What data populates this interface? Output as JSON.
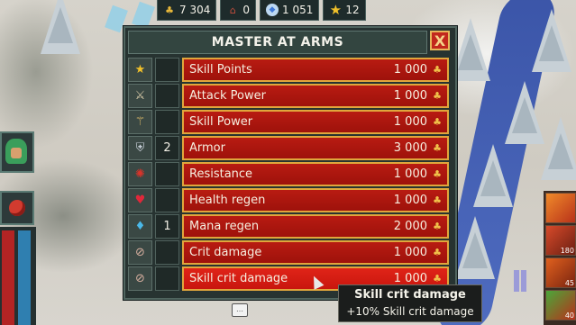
{
  "resources": [
    {
      "icon": "gold-coins-icon",
      "value": "7 304"
    },
    {
      "icon": "population-icon",
      "value": "0"
    },
    {
      "icon": "gem-icon",
      "value": "1 051"
    },
    {
      "icon": "star-icon",
      "value": "12"
    }
  ],
  "dialog": {
    "title": "MASTER AT ARMS",
    "close_label": "X",
    "rows": [
      {
        "icon": "star-icon",
        "level": "",
        "label": "Skill Points",
        "cost": "1 000"
      },
      {
        "icon": "sword-icon",
        "level": "",
        "label": "Attack Power",
        "cost": "1 000"
      },
      {
        "icon": "magic-wand-icon",
        "level": "",
        "label": "Skill Power",
        "cost": "1 000"
      },
      {
        "icon": "shield-icon",
        "level": "2",
        "label": "Armor",
        "cost": "3 000"
      },
      {
        "icon": "resistance-icon",
        "level": "",
        "label": "Resistance",
        "cost": "1 000"
      },
      {
        "icon": "heart-icon",
        "level": "",
        "label": "Health regen",
        "cost": "1 000"
      },
      {
        "icon": "mana-crystal-icon",
        "level": "1",
        "label": "Mana regen",
        "cost": "2 000"
      },
      {
        "icon": "crit-icon",
        "level": "",
        "label": "Crit damage",
        "cost": "1 000"
      },
      {
        "icon": "skill-crit-icon",
        "level": "",
        "label": "Skill crit damage",
        "cost": "1 000"
      }
    ]
  },
  "tooltip": {
    "title": "Skill crit damage",
    "description": "+10% Skill crit damage"
  },
  "skills": [
    {
      "icon": "fire-skill-icon",
      "count": ""
    },
    {
      "icon": "meteor-skill-icon",
      "count": "180"
    },
    {
      "icon": "fire-rain-skill-icon",
      "count": "45"
    },
    {
      "icon": "nature-skill-icon",
      "count": "40"
    }
  ],
  "colors": {
    "button_red": "#b81b12",
    "button_border": "#e0a63c",
    "panel": "#273331",
    "close_red": "#c2271d"
  }
}
